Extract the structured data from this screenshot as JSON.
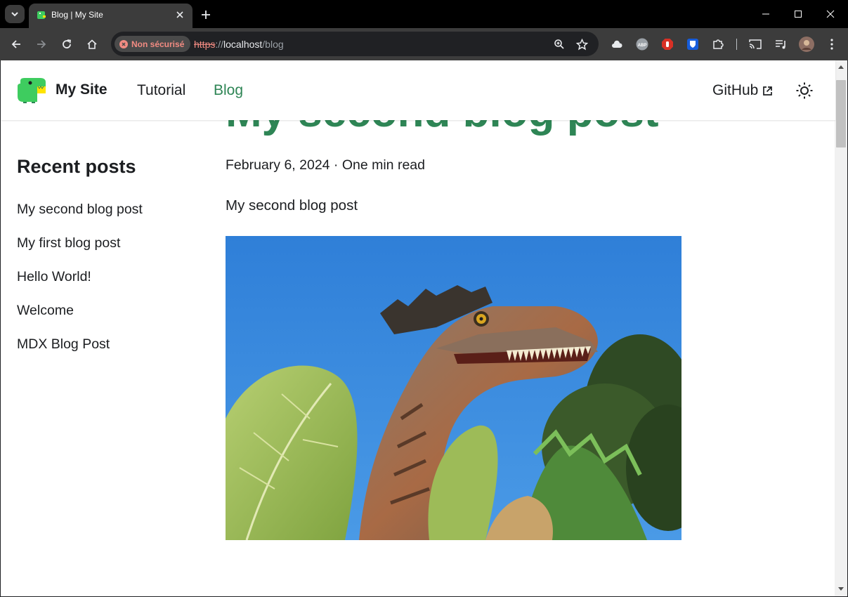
{
  "browser": {
    "tab_title": "Blog | My Site",
    "security_label": "Non sécurisé",
    "url_scheme": "https",
    "url_sep": "://",
    "url_host": "localhost",
    "url_path": "/blog",
    "error_color": "#f28b82",
    "extensions": [
      "cloud-icon",
      "adblock-icon",
      "hand-stop-icon",
      "bitwarden-icon",
      "puzzle-icon"
    ]
  },
  "site": {
    "brand_title": "My Site",
    "nav": {
      "tutorial": "Tutorial",
      "blog": "Blog",
      "github": "GitHub"
    },
    "accent_color": "#2e8555"
  },
  "sidebar": {
    "title": "Recent posts",
    "items": [
      {
        "label": "My second blog post"
      },
      {
        "label": "My first blog post"
      },
      {
        "label": "Hello World!"
      },
      {
        "label": "Welcome"
      },
      {
        "label": "MDX Blog Post"
      }
    ]
  },
  "post": {
    "title": "My second blog post",
    "meta": "February 6, 2024 · One min read",
    "body": "My second blog post",
    "image_subject": "dinosaur-image"
  }
}
